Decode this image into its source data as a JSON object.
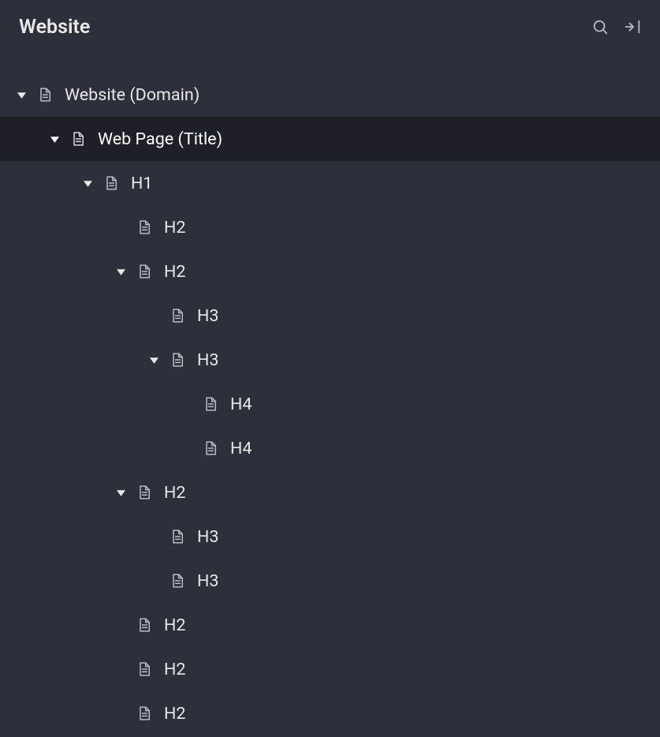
{
  "header": {
    "title": "Website"
  },
  "tree": [
    {
      "level": 0,
      "label": "Website (Domain)",
      "expanded": true,
      "hasChildren": true,
      "selected": false
    },
    {
      "level": 1,
      "label": "Web Page (Title)",
      "expanded": true,
      "hasChildren": true,
      "selected": true
    },
    {
      "level": 2,
      "label": "H1",
      "expanded": true,
      "hasChildren": true,
      "selected": false
    },
    {
      "level": 3,
      "label": "H2",
      "expanded": false,
      "hasChildren": false,
      "selected": false
    },
    {
      "level": 3,
      "label": "H2",
      "expanded": true,
      "hasChildren": true,
      "selected": false
    },
    {
      "level": 4,
      "label": "H3",
      "expanded": false,
      "hasChildren": false,
      "selected": false
    },
    {
      "level": 4,
      "label": "H3",
      "expanded": true,
      "hasChildren": true,
      "selected": false
    },
    {
      "level": 5,
      "label": "H4",
      "expanded": false,
      "hasChildren": false,
      "selected": false
    },
    {
      "level": 5,
      "label": "H4",
      "expanded": false,
      "hasChildren": false,
      "selected": false
    },
    {
      "level": 3,
      "label": "H2",
      "expanded": true,
      "hasChildren": true,
      "selected": false
    },
    {
      "level": 4,
      "label": "H3",
      "expanded": false,
      "hasChildren": false,
      "selected": false
    },
    {
      "level": 4,
      "label": "H3",
      "expanded": false,
      "hasChildren": false,
      "selected": false
    },
    {
      "level": 3,
      "label": "H2",
      "expanded": false,
      "hasChildren": false,
      "selected": false
    },
    {
      "level": 3,
      "label": "H2",
      "expanded": false,
      "hasChildren": false,
      "selected": false
    },
    {
      "level": 3,
      "label": "H2",
      "expanded": false,
      "hasChildren": false,
      "selected": false
    }
  ],
  "indentPx": 42
}
